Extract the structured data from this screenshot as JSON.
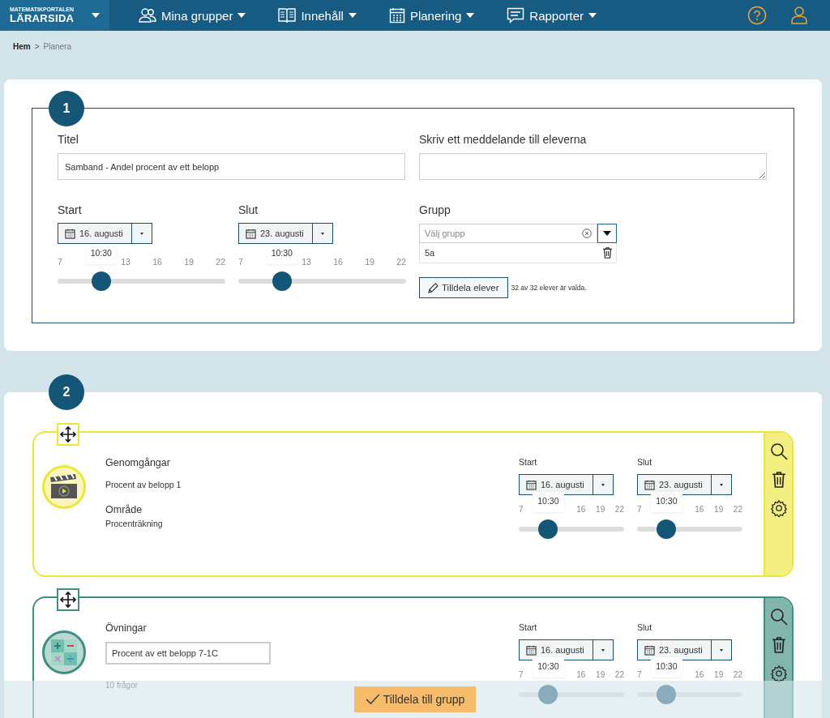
{
  "header": {
    "logo_small": "MATEMATIKPORTALEN",
    "logo": "LÄRARSIDA",
    "nav": [
      {
        "label": "Mina grupper",
        "kind": "groups"
      },
      {
        "label": "Innehåll",
        "kind": "content"
      },
      {
        "label": "Planering",
        "kind": "calendar"
      },
      {
        "label": "Rapporter",
        "kind": "report"
      }
    ]
  },
  "breadcrumb": [
    {
      "label": "Hem",
      "current": false
    },
    {
      "label": "Planera",
      "current": true
    }
  ],
  "breadcrumb_separator": ">",
  "section1": {
    "step": "1",
    "title_label": "Titel",
    "title_value": "Samband - Andel procent av ett belopp",
    "message_label": "Skriv ett meddelande till eleverna",
    "start": {
      "label": "Start",
      "date": "16. augusti",
      "time": "10:30",
      "ticks": [
        "7",
        "13",
        "16",
        "19",
        "22"
      ],
      "level": 0.26
    },
    "end": {
      "label": "Slut",
      "date": "23. augusti",
      "time": "10:30",
      "ticks": [
        "7",
        "13",
        "16",
        "19",
        "22"
      ],
      "level": 0.26
    },
    "group": {
      "label": "Grupp",
      "placeholder": "Välj grupp",
      "items": [
        "5a"
      ]
    },
    "assign_button": "Tilldela elever",
    "assign_status": "32 av 32 elever är valda."
  },
  "section2": {
    "step": "2",
    "cards": [
      {
        "kind": "video",
        "color": "#ece63c",
        "category": "Genomgångar",
        "title": "Procent av belopp 1",
        "area_label": "Område",
        "area_value": "Procenträkning",
        "start": {
          "label": "Start",
          "date": "16. augusti",
          "time": "10:30",
          "ticks": [
            "7",
            "16",
            "19",
            "22"
          ],
          "level": 0.28
        },
        "end": {
          "label": "Slut",
          "date": "23. augusti",
          "time": "10:30",
          "ticks": [
            "7",
            "16",
            "19",
            "22"
          ],
          "level": 0.28
        }
      },
      {
        "kind": "exercise",
        "color": "#3e8f80",
        "category": "Övningar",
        "title": "Procent av ett belopp 7-1C",
        "count": "10 frågor",
        "start": {
          "label": "Start",
          "date": "16. augusti",
          "time": "10:30",
          "ticks": [
            "7",
            "16",
            "19",
            "22"
          ],
          "level": 0.28
        },
        "end": {
          "label": "Slut",
          "date": "23. augusti",
          "time": "10:30",
          "ticks": [
            "7",
            "16",
            "19",
            "22"
          ],
          "level": 0.28
        }
      }
    ],
    "submit_button": "Tilldela till grupp"
  }
}
